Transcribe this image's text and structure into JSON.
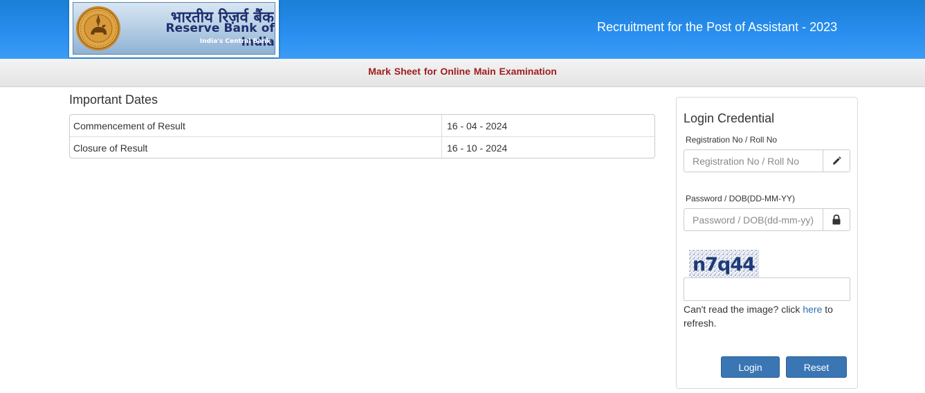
{
  "header": {
    "logo": {
      "hindi_name": "भारतीय रिज़र्व बैंक",
      "english_name": "Reserve Bank of India",
      "tagline": "India's Central Bank",
      "seal_text": "RESERVE BANK OF INDIA"
    },
    "title": "Recruitment for the Post of Assistant - 2023"
  },
  "subheader": {
    "title": "Mark Sheet for Online Main Examination"
  },
  "important_dates": {
    "heading": "Important Dates",
    "rows": [
      {
        "label": "Commencement of Result",
        "value": "16 - 04 - 2024"
      },
      {
        "label": "Closure of Result",
        "value": "16 - 10 - 2024"
      }
    ]
  },
  "login": {
    "title": "Login Credential",
    "registration": {
      "label": "Registration No / Roll No",
      "placeholder": "Registration No / Roll No",
      "value": "",
      "icon": "pencil-icon"
    },
    "password": {
      "label": "Password / DOB(DD-MM-YY)",
      "placeholder": "Password / DOB(dd-mm-yy)",
      "value": "",
      "icon": "lock-icon"
    },
    "captcha": {
      "text": "n7q44",
      "input_value": ""
    },
    "refresh": {
      "prefix": "Can't read the image? click",
      "link": "here",
      "suffix": "to refresh."
    },
    "buttons": {
      "login": "Login",
      "reset": "Reset"
    }
  },
  "colors": {
    "header_blue": "#2a8ff0",
    "subheader_text": "#a01c1c",
    "button_blue": "#3a76b4",
    "link_blue": "#2a6fb3"
  }
}
